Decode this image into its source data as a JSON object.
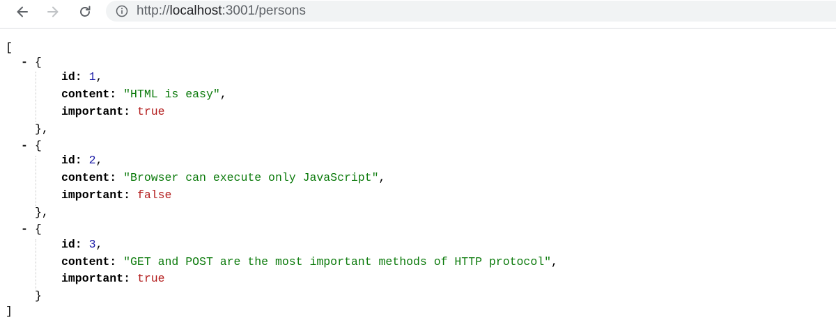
{
  "browser": {
    "url_scheme": "http://",
    "url_host": "localhost",
    "url_path": ":3001/persons",
    "icons": [
      "back-icon",
      "forward-icon",
      "reload-icon",
      "info-icon"
    ]
  },
  "json_viewer": {
    "open_bracket": "[",
    "close_bracket": "]",
    "toggle": "-",
    "open_brace": "{",
    "close_brace_comma": "},",
    "close_brace": "}",
    "items": [
      {
        "id_key": "id:",
        "id_value": "1",
        "content_key": "content:",
        "content_value": "\"HTML is easy\"",
        "important_key": "important:",
        "important_value": "true"
      },
      {
        "id_key": "id:",
        "id_value": "2",
        "content_key": "content:",
        "content_value": "\"Browser can execute only JavaScript\"",
        "important_key": "important:",
        "important_value": "false"
      },
      {
        "id_key": "id:",
        "id_value": "3",
        "content_key": "content:",
        "content_value": "\"GET and POST are the most important methods of HTTP protocol\"",
        "important_key": "important:",
        "important_value": "true"
      }
    ]
  }
}
